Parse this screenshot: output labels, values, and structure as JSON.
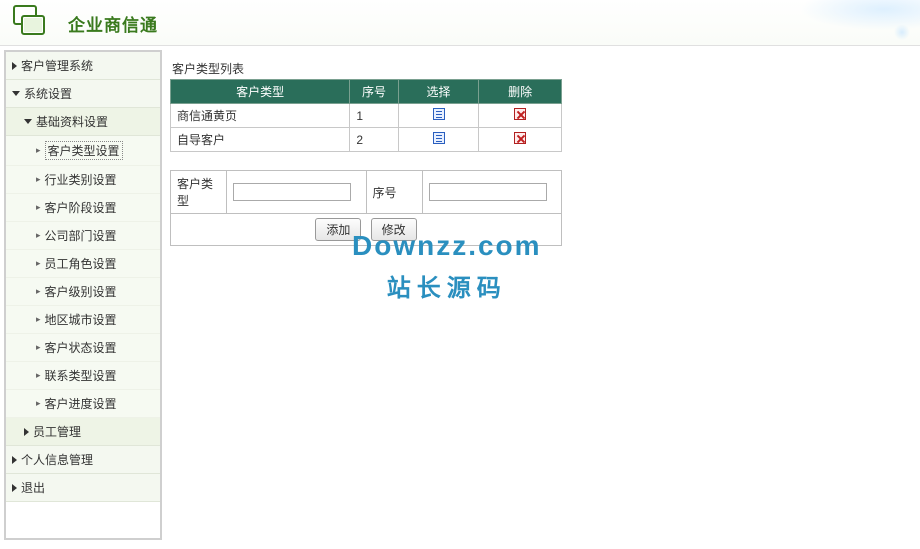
{
  "header": {
    "app_title": "企业商信通"
  },
  "sidebar": {
    "items": [
      {
        "label": "客户管理系统",
        "level": 1,
        "expanded": false
      },
      {
        "label": "系统设置",
        "level": 1,
        "expanded": true
      },
      {
        "label": "基础资料设置",
        "level": 2,
        "expanded": true
      },
      {
        "label": "客户类型设置",
        "level": 3,
        "active": true
      },
      {
        "label": "行业类别设置",
        "level": 3
      },
      {
        "label": "客户阶段设置",
        "level": 3
      },
      {
        "label": "公司部门设置",
        "level": 3
      },
      {
        "label": "员工角色设置",
        "level": 3
      },
      {
        "label": "客户级别设置",
        "level": 3
      },
      {
        "label": "地区城市设置",
        "level": 3
      },
      {
        "label": "客户状态设置",
        "level": 3
      },
      {
        "label": "联系类型设置",
        "level": 3
      },
      {
        "label": "客户进度设置",
        "level": 3
      },
      {
        "label": "员工管理",
        "level": 2,
        "expanded": false
      },
      {
        "label": "个人信息管理",
        "level": 1,
        "expanded": false
      },
      {
        "label": "退出",
        "level": 1,
        "expanded": false
      }
    ]
  },
  "main": {
    "list_title": "客户类型列表",
    "columns": {
      "name": "客户类型",
      "seq": "序号",
      "select": "选择",
      "delete": "删除"
    },
    "rows": [
      {
        "name": "商信通黄页",
        "seq": "1"
      },
      {
        "name": "自导客户",
        "seq": "2"
      }
    ],
    "form": {
      "name_label": "客户类型",
      "name_value": "",
      "seq_label": "序号",
      "seq_value": "",
      "add_btn": "添加",
      "edit_btn": "修改"
    }
  },
  "watermark": {
    "line1": "Downzz.com",
    "line2": "站长源码"
  }
}
